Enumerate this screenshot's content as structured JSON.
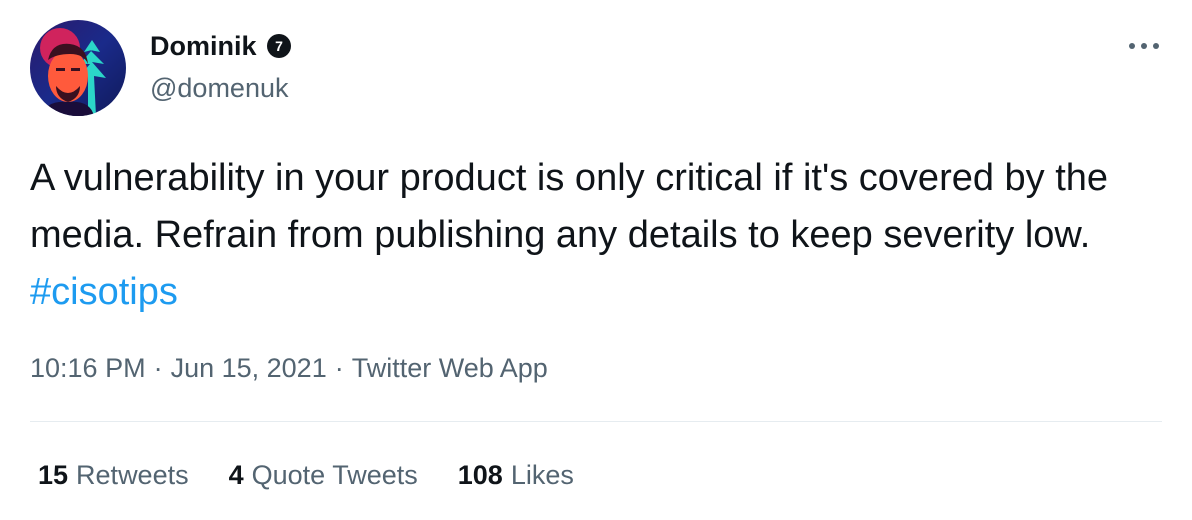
{
  "author": {
    "display_name": "Dominik",
    "handle": "@domenuk",
    "badge_number": "7",
    "avatar_icon": "avatar-illustration"
  },
  "tweet": {
    "text_before": "A vulnerability in your product is only critical if it's covered by the media. Refrain from publishing any details to keep severity low.",
    "hashtag": "#cisotips"
  },
  "meta": {
    "time": "10:16 PM",
    "separator": "·",
    "date": "Jun 15, 2021",
    "source": "Twitter Web App"
  },
  "stats": {
    "retweets_count": "15",
    "retweets_label": "Retweets",
    "quotes_count": "4",
    "quotes_label": "Quote Tweets",
    "likes_count": "108",
    "likes_label": "Likes"
  },
  "colors": {
    "text": "#0f1419",
    "secondary": "#536471",
    "link": "#1d9bf0",
    "divider": "#e6ecf0"
  },
  "icons": {
    "more": "more-horizontal-icon",
    "badge": "number-badge-icon"
  }
}
